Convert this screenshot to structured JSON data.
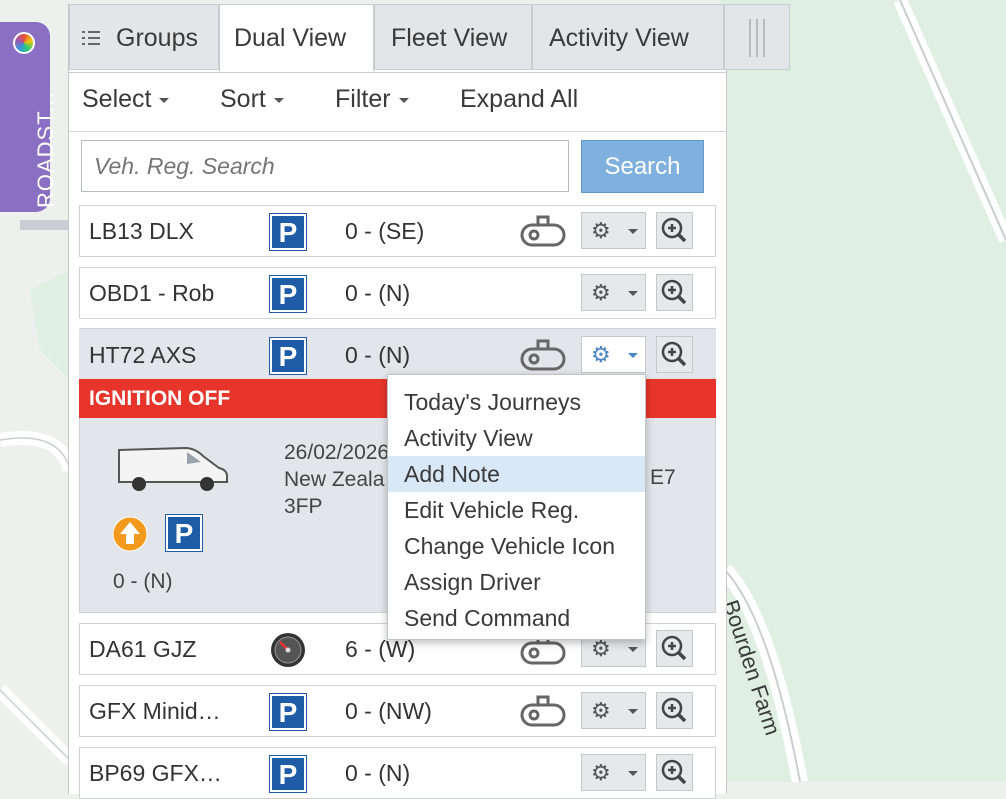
{
  "app": {
    "side_tab_label": "ROADST..."
  },
  "tabs": [
    {
      "label": "Groups",
      "icon": "list-icon"
    },
    {
      "label": "Dual View",
      "active": true
    },
    {
      "label": "Fleet View"
    },
    {
      "label": "Activity View"
    }
  ],
  "toolbar": {
    "select": "Select",
    "sort": "Sort",
    "filter": "Filter",
    "expand_all": "Expand All"
  },
  "search": {
    "placeholder": "Veh. Reg. Search",
    "button": "Search"
  },
  "vehicles": [
    {
      "reg": "LB13 DLX",
      "status_icon": "parked-icon",
      "speed": "0 - (SE)",
      "obd": true
    },
    {
      "reg": "OBD1 - Rob",
      "status_icon": "parked-icon",
      "speed": "0 - (N)",
      "obd": false
    },
    {
      "reg": "HT72 AXS",
      "status_icon": "parked-icon",
      "speed": "0 - (N)",
      "obd": true,
      "expanded": true
    },
    {
      "reg": "DA61 GJZ",
      "status_icon": "speedometer-icon",
      "speed": "6 - (W)",
      "obd": true
    },
    {
      "reg": "GFX Minid…",
      "status_icon": "parked-icon",
      "speed": "0 - (NW)",
      "obd": true
    },
    {
      "reg": "BP69 GFX…",
      "status_icon": "parked-icon",
      "speed": "0 - (N)",
      "obd": false
    }
  ],
  "expanded_detail": {
    "ignition": "IGNITION OFF",
    "date": "26/02/2026",
    "address_line1": "New Zeala",
    "address_suffix": "E7",
    "address_line2": "3FP",
    "speed": "0 - (N)"
  },
  "context_menu": {
    "items": [
      "Today's Journeys",
      "Activity View",
      "Add Note",
      "Edit Vehicle Reg.",
      "Change Vehicle Icon",
      "Assign Driver",
      "Send Command"
    ],
    "highlighted": "Add Note"
  },
  "map": {
    "road_label": "Bourden Farm"
  },
  "colors": {
    "accent": "#7fb0de",
    "ignition_off": "#e8352b",
    "parked": "#1f5ca8",
    "side_tab": "#8a6fc2",
    "park_green": "#dff0e3"
  }
}
